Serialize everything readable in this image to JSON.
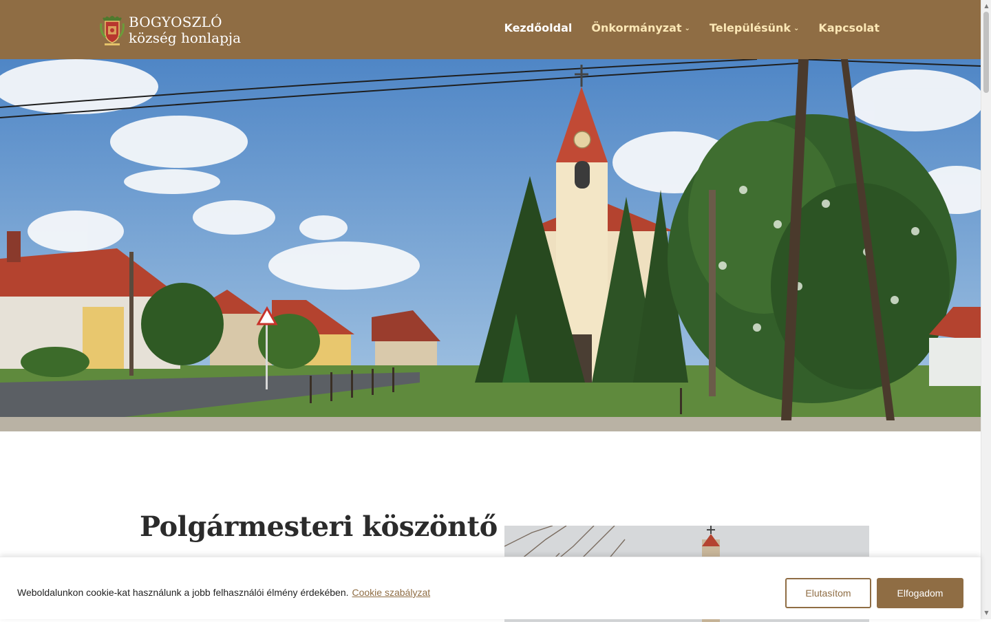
{
  "header": {
    "logo_title": "BOGYOSZLÓ",
    "logo_subtitle": "község honlapja",
    "logo_icon": "coat-of-arms"
  },
  "nav": {
    "items": [
      {
        "label": "Kezdőoldal",
        "active": true,
        "has_dropdown": false
      },
      {
        "label": "Önkormányzat",
        "active": false,
        "has_dropdown": true
      },
      {
        "label": "Településünk",
        "active": false,
        "has_dropdown": true
      },
      {
        "label": "Kapcsolat",
        "active": false,
        "has_dropdown": false
      }
    ],
    "dropdown_icon": "chevron-down-icon"
  },
  "main": {
    "welcome_title": "Polgármesteri köszöntő"
  },
  "cookie": {
    "text": "Weboldalunkon cookie-kat használunk a jobb felhasználói élmény érdekében.",
    "link": "Cookie szabályzat",
    "decline": "Elutasítom",
    "accept": "Elfogadom"
  },
  "colors": {
    "brand": "#8f6d44",
    "nav_text": "#fbe7b5",
    "nav_active": "#ffffff"
  }
}
